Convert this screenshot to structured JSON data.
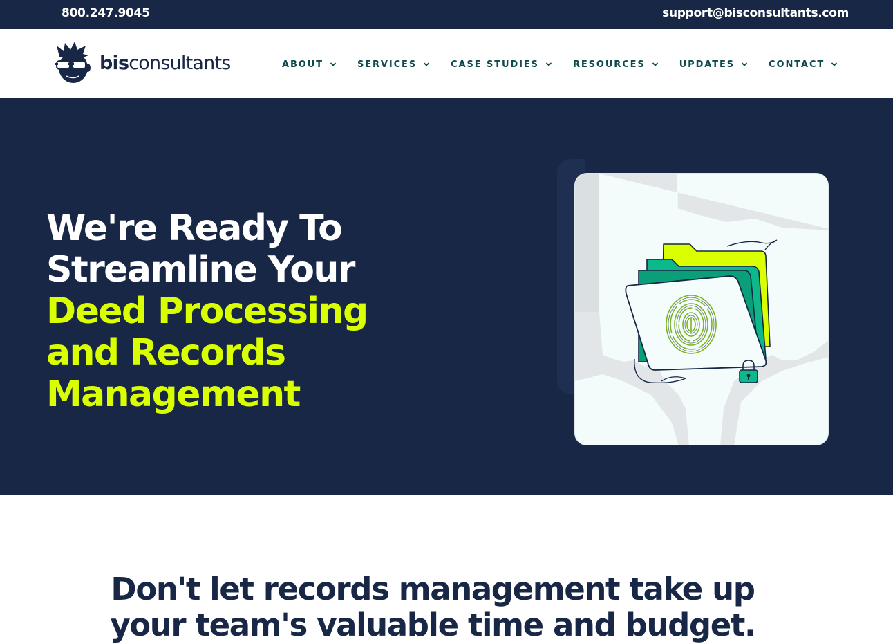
{
  "topbar": {
    "phone": "800.247.9045",
    "email": "support@bisconsultants.com"
  },
  "brand": {
    "name_bold": "bis",
    "name_light": "consultants",
    "logo_icon": "glasses-mascot-icon"
  },
  "nav": {
    "items": [
      {
        "label": "ABOUT",
        "icon": "chevron-down-icon"
      },
      {
        "label": "SERVICES",
        "icon": "chevron-down-icon"
      },
      {
        "label": "CASE STUDIES",
        "icon": "chevron-down-icon"
      },
      {
        "label": "RESOURCES",
        "icon": "chevron-down-icon"
      },
      {
        "label": "UPDATES",
        "icon": "chevron-down-icon"
      },
      {
        "label": "CONTACT",
        "icon": "chevron-down-icon"
      }
    ]
  },
  "hero": {
    "title_white": [
      "We're Ready To",
      "Streamline Your"
    ],
    "title_lime": [
      "Deed Processing",
      "and Records",
      "Management"
    ],
    "illustration": "fingerprint-folder-illustration"
  },
  "section": {
    "heading_lines": [
      "Don't let records management take up",
      "your team's valuable time and budget."
    ]
  },
  "colors": {
    "navy": "#172745",
    "lime": "#d9ff00",
    "teal_nav": "#0e4a4c",
    "green": "#0db98a"
  }
}
